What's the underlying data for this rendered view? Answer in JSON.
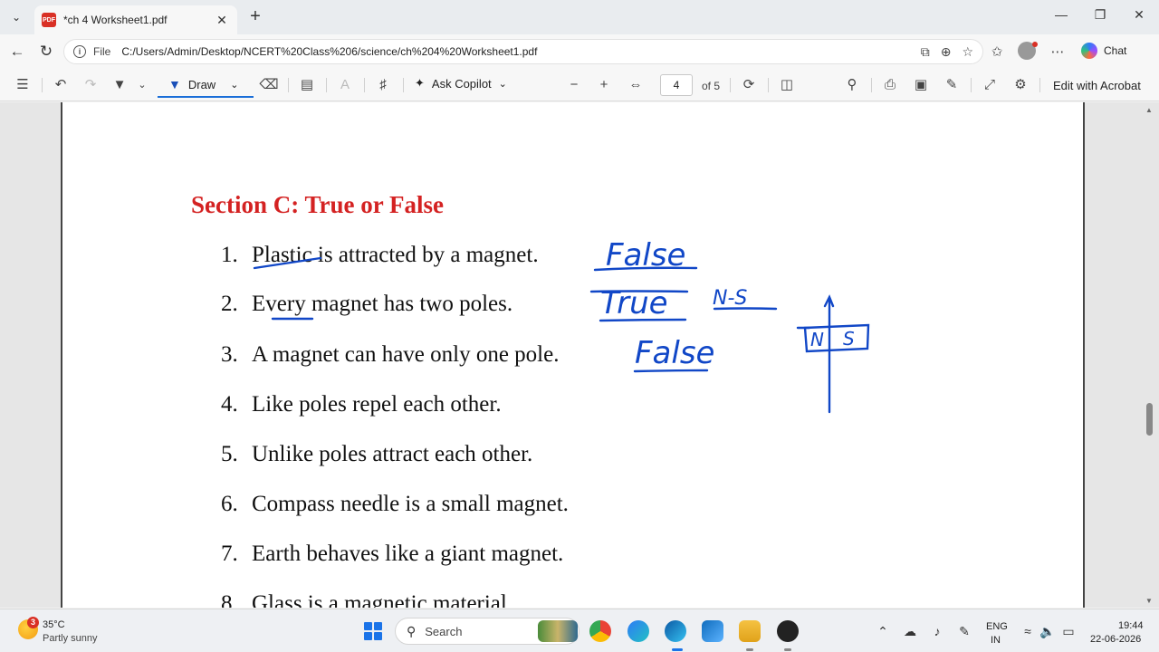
{
  "tab": {
    "title": "*ch 4 Worksheet1.pdf",
    "icon_text": "PDF"
  },
  "address": {
    "scheme_label": "File",
    "url": "C:/Users/Admin/Desktop/NCERT%20Class%206/science/ch%204%20Worksheet1.pdf"
  },
  "browser": {
    "chat_label": "Chat"
  },
  "pdf_toolbar": {
    "draw_label": "Draw",
    "ask_copilot_label": "Ask Copilot",
    "current_page": "4",
    "page_total_label": "of 5",
    "edit_acrobat_label": "Edit with Acrobat"
  },
  "document": {
    "section_title": "Section C: True or False",
    "questions": [
      {
        "num": "1.",
        "text": "Plastic is attracted by a magnet."
      },
      {
        "num": "2.",
        "text": "Every magnet has two poles."
      },
      {
        "num": "3.",
        "text": "A magnet can have only one pole."
      },
      {
        "num": "4.",
        "text": "Like poles repel each other."
      },
      {
        "num": "5.",
        "text": "Unlike poles attract each other."
      },
      {
        "num": "6.",
        "text": "Compass needle is a small magnet."
      },
      {
        "num": "7.",
        "text": "Earth behaves like a giant magnet."
      },
      {
        "num": "8.",
        "text": "Glass is a magnetic material."
      }
    ],
    "annotations": {
      "answer_1": "False",
      "answer_2": "True",
      "note_2": "N-S",
      "answer_3": "False",
      "sketch_n": "N",
      "sketch_s": "S"
    },
    "ink_color": "#1147c7"
  },
  "taskbar": {
    "weather_badge": "3",
    "weather_temp": "35°C",
    "weather_desc": "Partly sunny",
    "search_label": "Search",
    "lang_top": "ENG",
    "lang_bottom": "IN",
    "time": "19:44",
    "date": "22-06-2026"
  }
}
